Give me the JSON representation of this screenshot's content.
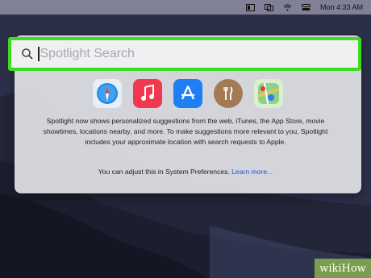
{
  "menubar": {
    "time": "Mon 4:33 AM",
    "icons": [
      "screen-mirror-icon",
      "display-icon",
      "wifi-icon",
      "control-center-icon"
    ]
  },
  "search": {
    "placeholder": "Spotlight Search"
  },
  "suggested_apps": [
    {
      "name": "Safari",
      "icon": "safari-icon",
      "color": "#1e88e5"
    },
    {
      "name": "Music",
      "icon": "music-icon",
      "color": "#f2384f"
    },
    {
      "name": "App Store",
      "icon": "app-store-icon",
      "color": "#1e7ff5"
    },
    {
      "name": "Restaurants",
      "icon": "fork-knife-icon",
      "color": "#a47a55"
    },
    {
      "name": "Maps",
      "icon": "maps-icon",
      "color": "#5dbb63"
    }
  ],
  "message": {
    "body": "Spotlight now shows personalized suggestions from the web, iTunes, the App Store, movie showtimes, locations nearby, and more. To make suggestions more relevant to you, Spotlight includes your approximate location with search requests to Apple.",
    "prefs_text": "You can adjust this in System Preferences. ",
    "learn_more": "Learn more..."
  },
  "watermark": "wikiHow",
  "colors": {
    "highlight": "#3ddc1f",
    "link": "#1a5ad6"
  }
}
